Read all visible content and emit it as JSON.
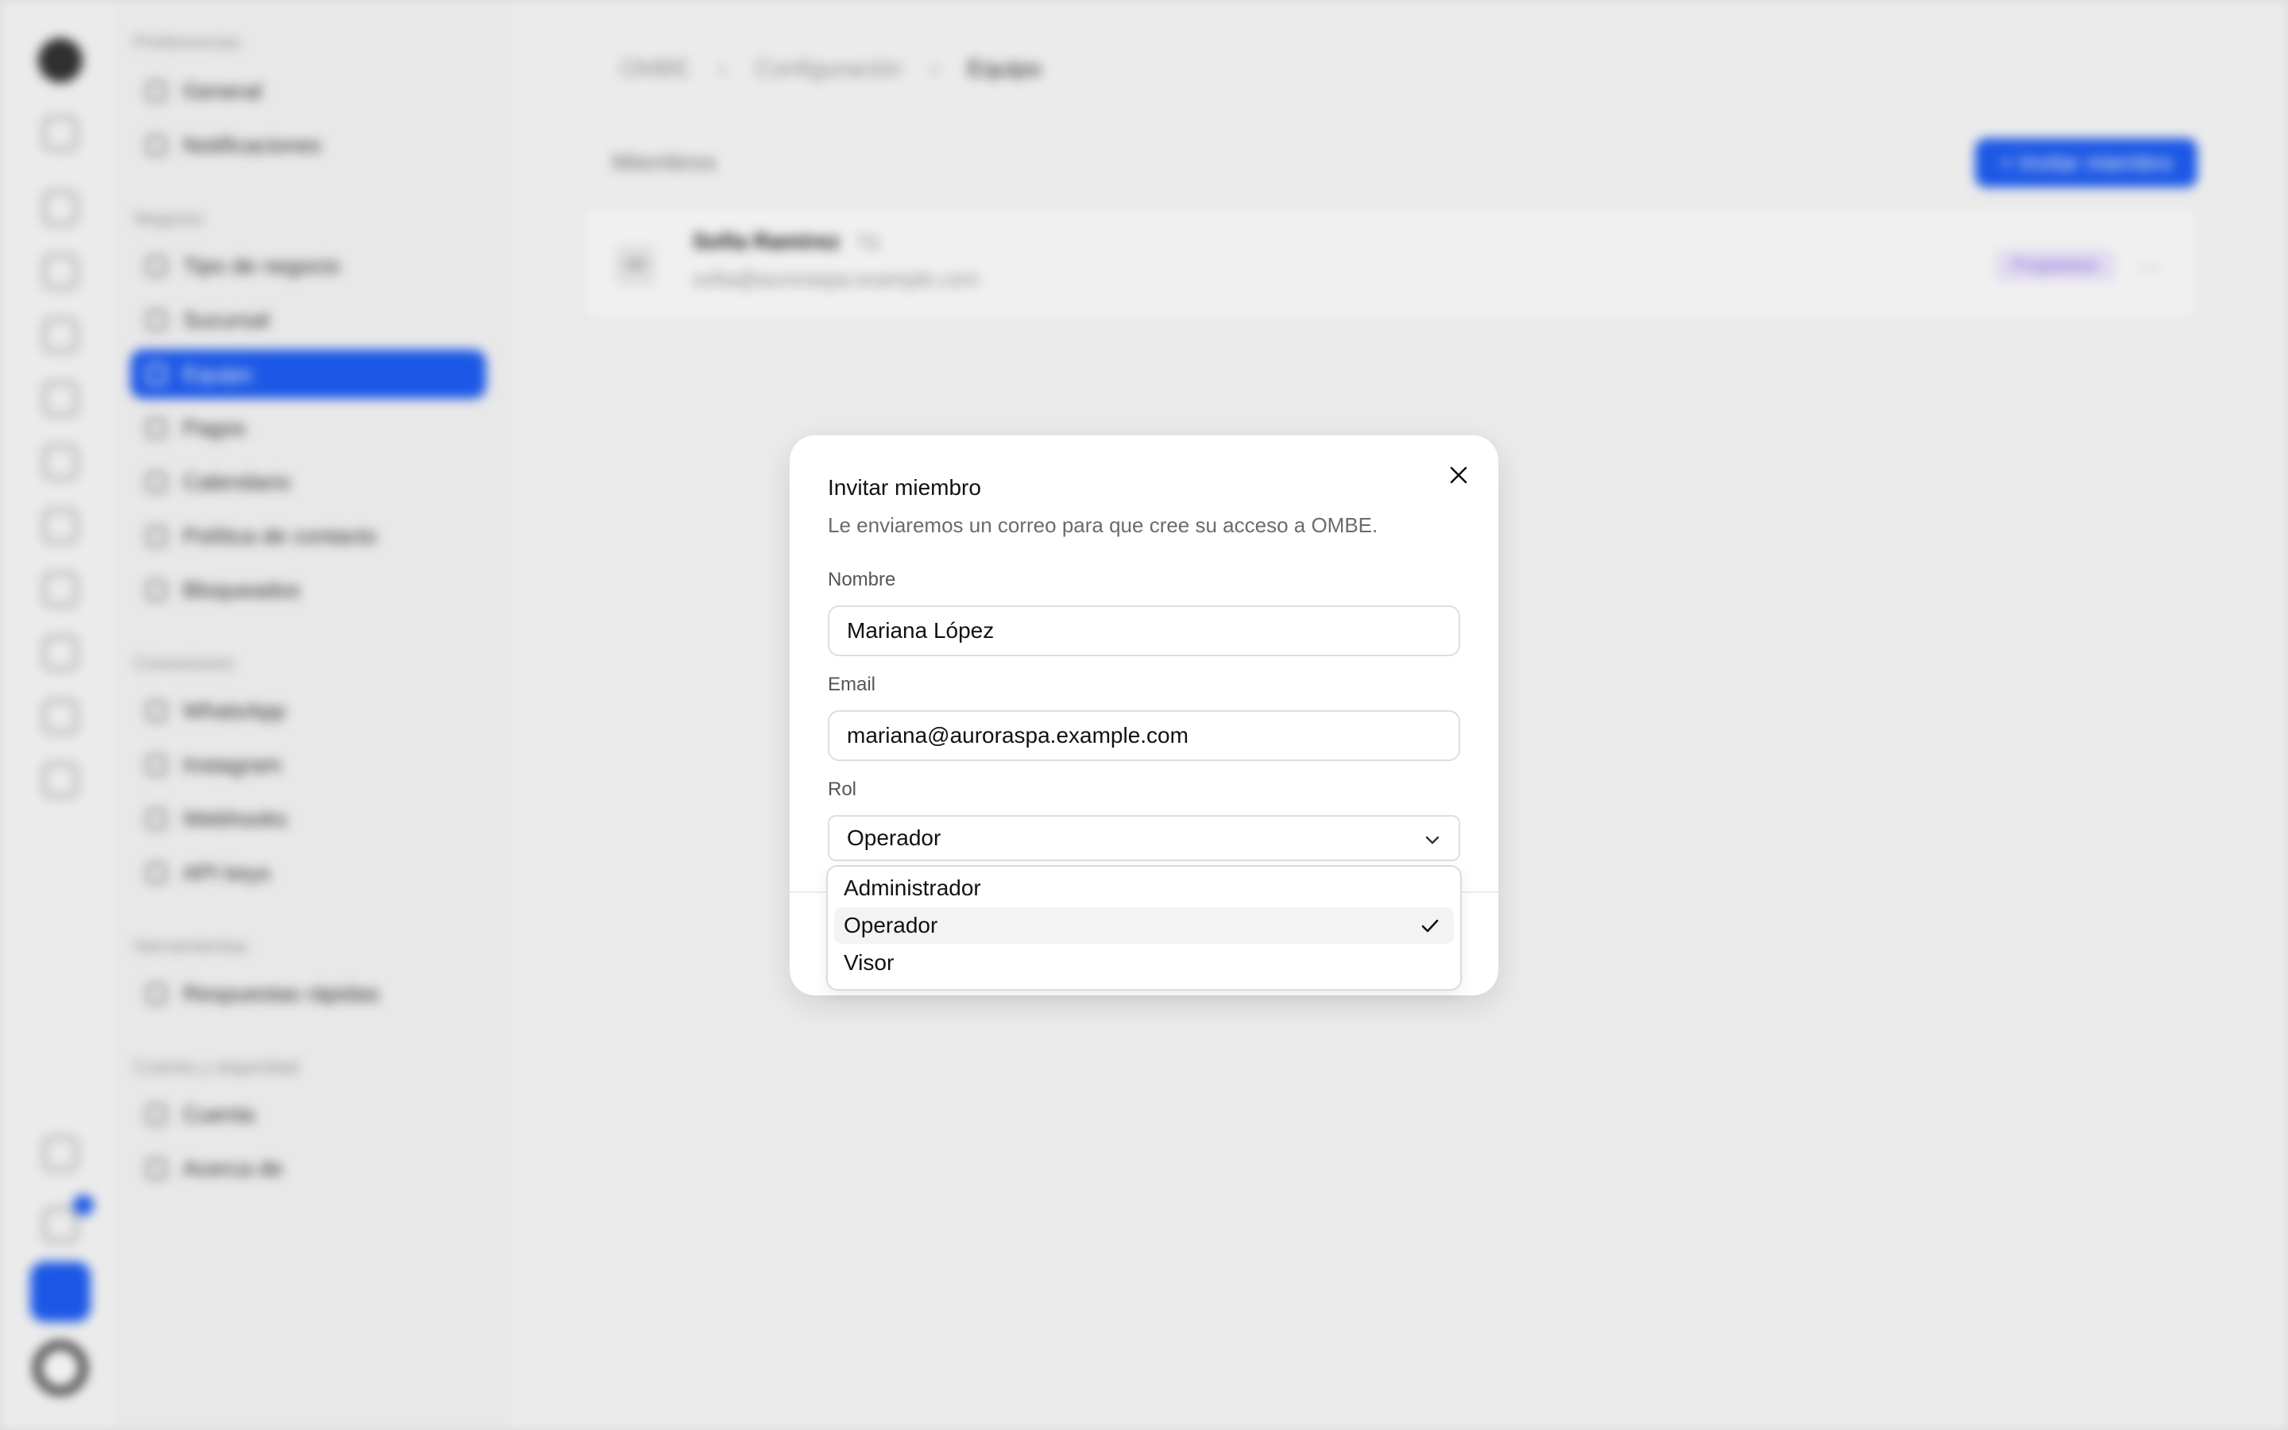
{
  "background": {
    "sidebar": {
      "groups": [
        {
          "label": "Preferencias",
          "items": [
            "General",
            "Notificaciones"
          ]
        },
        {
          "label": "Negocio",
          "items": [
            "Tipo de negocio",
            "Sucursal",
            "Equipo",
            "Pagos",
            "Calendario",
            "Política de contacto",
            "Bloqueados"
          ]
        },
        {
          "label": "Conexiones",
          "items": [
            "WhatsApp",
            "Instagram",
            "Webhooks",
            "API keys"
          ]
        },
        {
          "label": "Herramientas",
          "items": [
            "Respuestas rápidas"
          ]
        },
        {
          "label": "Cuenta y seguridad",
          "items": [
            "Cuenta",
            "Acerca de"
          ]
        }
      ],
      "active_item": "Equipo"
    },
    "breadcrumb": [
      "OMBE",
      "Configuración",
      "Equipo"
    ],
    "members_title": "Miembros",
    "invite_button": "+ Invitar miembro",
    "member": {
      "initials": "SR",
      "name": "Sofía Ramírez",
      "tag": "Tú",
      "email": "sofia@auroraspa.example.com",
      "role": "Propietario"
    }
  },
  "modal": {
    "title": "Invitar miembro",
    "description": "Le enviaremos un correo para que cree su acceso a OMBE.",
    "name_label": "Nombre",
    "name_value": "Mariana López",
    "email_label": "Email",
    "email_value": "mariana@auroraspa.example.com",
    "role_label": "Rol",
    "role_value": "Operador",
    "role_options": [
      "Administrador",
      "Operador",
      "Visor"
    ]
  },
  "colors": {
    "accent": "#1e5ef5"
  }
}
